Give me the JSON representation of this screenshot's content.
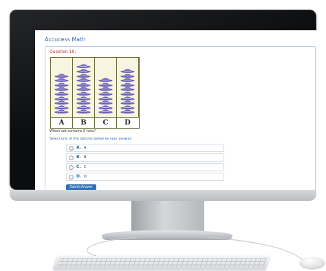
{
  "app": {
    "title": "Accucess Math"
  },
  "question": {
    "title": "Question 19:",
    "figure": {
      "column_labels": [
        "A",
        "B",
        "C",
        "D"
      ],
      "hat_counts": [
        9,
        11,
        8,
        10
      ],
      "hat_color": "#7b6fd0",
      "frame_color": "#6b6a38"
    },
    "text": "Which set contains 8 hats?",
    "instruction": "Select one of the options below as your answer:",
    "options": [
      {
        "letter": "A.",
        "text": "A"
      },
      {
        "letter": "B.",
        "text": "B"
      },
      {
        "letter": "C.",
        "text": "C"
      },
      {
        "letter": "D.",
        "text": "D"
      }
    ],
    "submit_label": "Submit Answer"
  },
  "colors": {
    "accent": "#2b6cb0",
    "question_title": "#b03030",
    "button": "#2f72b8"
  }
}
